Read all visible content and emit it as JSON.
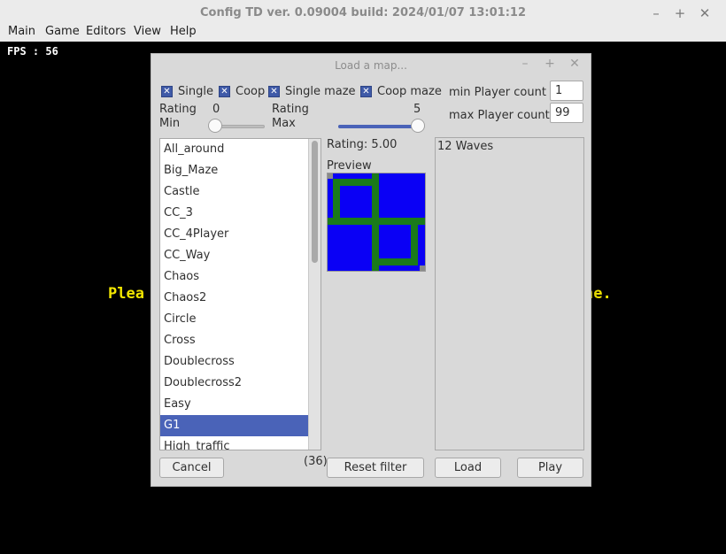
{
  "window": {
    "title": "Config TD ver. 0.09004 build: 2024/01/07  13:01:12"
  },
  "window_controls": {
    "minimize": "–",
    "maximize": "+",
    "close": "✕"
  },
  "menu": [
    "Main",
    "Game",
    "Editors",
    "View",
    "Help"
  ],
  "game": {
    "fps_text": "FPS : 56",
    "message_left": "Plea",
    "message_right": "ne."
  },
  "dialog": {
    "title": "Load a map...",
    "controls": {
      "minimize": "–",
      "maximize": "+",
      "close": "✕"
    },
    "filters": [
      {
        "label": "Single",
        "checked": true
      },
      {
        "label": "Coop",
        "checked": true
      },
      {
        "label": "Single maze",
        "checked": true
      },
      {
        "label": "Coop maze",
        "checked": true
      }
    ],
    "check_mark": "✕",
    "min_player_label": "min Player count",
    "min_player_value": "1",
    "max_player_label": "max Player count",
    "max_player_value": "99",
    "rating_min": {
      "label_line1": "Rating",
      "label_line2": "Min",
      "value": "0",
      "level": 0.0
    },
    "rating_max": {
      "label_line1": "Rating",
      "label_line2": "Max",
      "value": "5",
      "level": 1.0
    },
    "maps": [
      "All_around",
      "Big_Maze",
      "Castle",
      "CC_3",
      "CC_4Player",
      "CC_Way",
      "Chaos",
      "Chaos2",
      "Circle",
      "Cross",
      "Doublecross",
      "Doublecross2",
      "Easy",
      "G1",
      "High_traffic"
    ],
    "selected_map": "G1",
    "rating_text": "Rating:  5.00",
    "preview_label": "Preview",
    "description": "12 Waves",
    "count_text": "(36)",
    "buttons": {
      "cancel": "Cancel",
      "reset": "Reset filter",
      "load": "Load",
      "play": "Play"
    }
  },
  "colors": {
    "accent": "#4a63b8",
    "preview_bg": "#0a00f5",
    "preview_path": "#1a7a1a",
    "message": "#f2e600"
  }
}
